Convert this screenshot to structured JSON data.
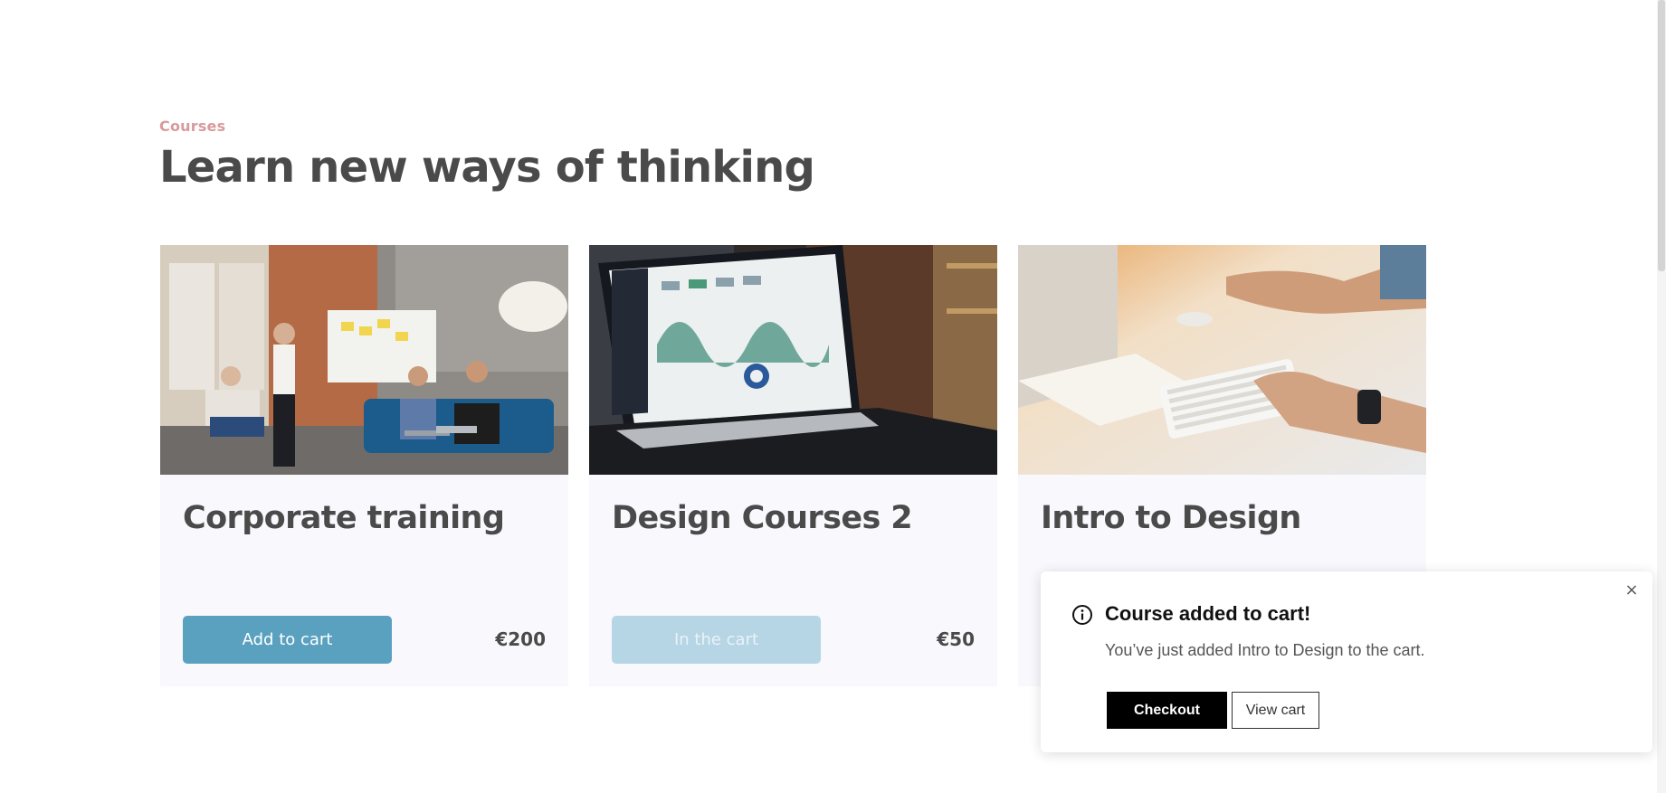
{
  "section": {
    "eyebrow": "Courses",
    "heading": "Learn new ways of thinking"
  },
  "courses": [
    {
      "title": "Corporate training",
      "button_label": "Add to cart",
      "button_state": "enabled",
      "price": "€200",
      "image_icon": "team-meeting-photo"
    },
    {
      "title": "Design Courses 2",
      "button_label": "In the cart",
      "button_state": "disabled",
      "price": "€50",
      "image_icon": "laptop-dashboard-photo"
    },
    {
      "title": "Intro to Design",
      "button_label": "",
      "button_state": "hidden",
      "price": "",
      "image_icon": "keyboard-typing-photo"
    }
  ],
  "toast": {
    "title": "Course added to cart!",
    "message": "You’ve just added Intro to Design to the cart.",
    "primary_label": "Checkout",
    "secondary_label": "View cart",
    "close_glyph": "×"
  },
  "colors": {
    "accent": "#5aa0bf",
    "accent_disabled": "#b6d5e5",
    "eyebrow": "#d99a9d",
    "heading": "#4a4a4a",
    "card_bg": "#f9f8fd"
  }
}
